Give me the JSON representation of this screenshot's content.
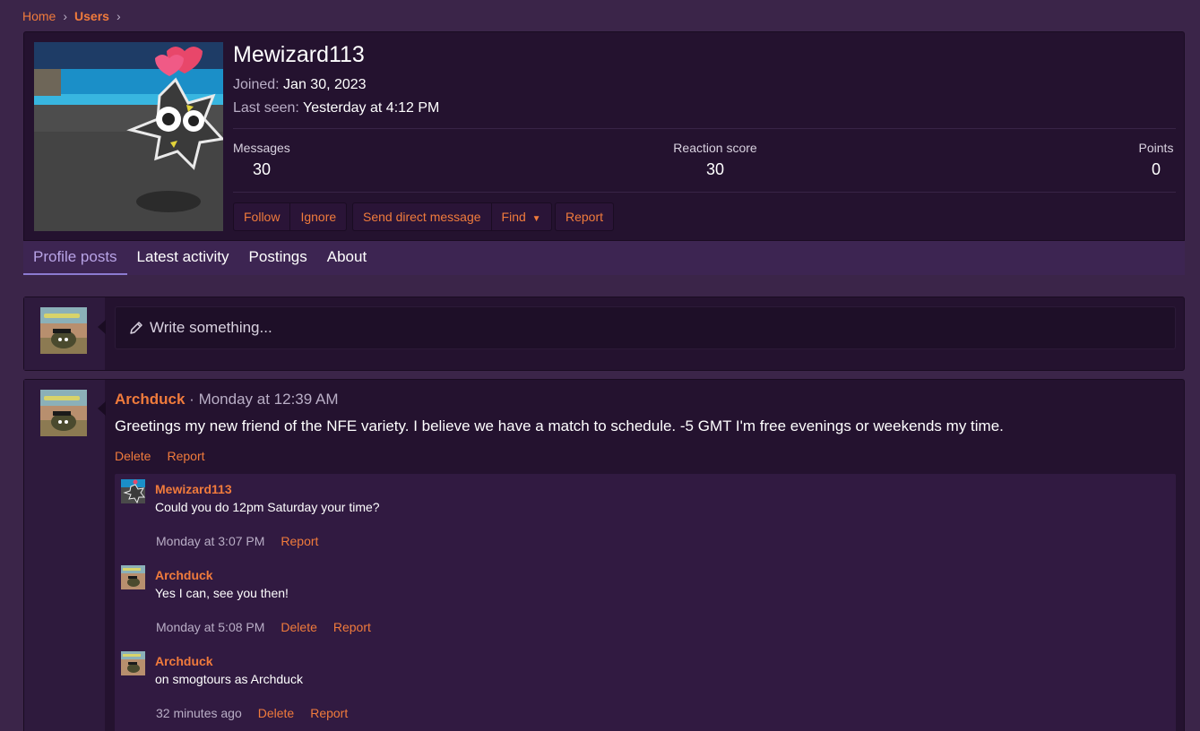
{
  "breadcrumb": {
    "home": "Home",
    "users": "Users"
  },
  "profile": {
    "username": "Mewizard113",
    "joined_label": "Joined:",
    "joined_value": "Jan 30, 2023",
    "seen_label": "Last seen:",
    "seen_value": "Yesterday at 4:12 PM",
    "stats": [
      {
        "label": "Messages",
        "value": "30"
      },
      {
        "label": "Reaction score",
        "value": "30"
      },
      {
        "label": "Points",
        "value": "0"
      }
    ],
    "buttons": {
      "follow": "Follow",
      "ignore": "Ignore",
      "send_dm": "Send direct message",
      "find": "Find",
      "report": "Report"
    }
  },
  "tabs": [
    "Profile posts",
    "Latest activity",
    "Postings",
    "About"
  ],
  "composer": {
    "placeholder": "Write something..."
  },
  "post": {
    "author": "Archduck",
    "separator": "·",
    "datetime": "Monday at 12:39 AM",
    "body": "Greetings my new friend of the NFE variety. I believe we have a match to schedule. -5 GMT I'm free evenings or weekends my time.",
    "actions": {
      "delete": "Delete",
      "report": "Report"
    },
    "comments": [
      {
        "author": "Mewizard113",
        "text": "Could you do 12pm Saturday your time?",
        "time": "Monday at 3:07 PM",
        "actions": [
          "Report"
        ]
      },
      {
        "author": "Archduck",
        "text": "Yes I can, see you then!",
        "time": "Monday at 5:08 PM",
        "actions": [
          "Delete",
          "Report"
        ]
      },
      {
        "author": "Archduck",
        "text": "on smogtours as Archduck",
        "time": "32 minutes ago",
        "actions": [
          "Delete",
          "Report"
        ]
      }
    ]
  },
  "colors": {
    "accent": "#f07b3c",
    "background": "#3b2549",
    "panel": "#24122f",
    "tab_active": "#b8a3e6"
  }
}
